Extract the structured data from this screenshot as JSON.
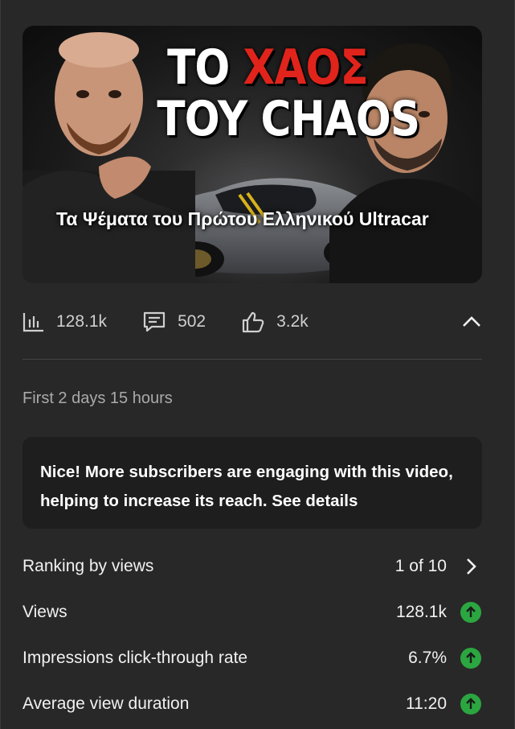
{
  "thumbnail": {
    "title_line1_white": "TO",
    "title_line1_red": "ΧΑΟΣ",
    "title_line2": "TOY CHAOS",
    "caption": "Τα Ψέματα του Πρώτου Ελληνικού Ultracar"
  },
  "stats": {
    "views": "128.1k",
    "comments": "502",
    "likes": "3.2k",
    "views_icon": "bar-chart-icon",
    "comments_icon": "comment-icon",
    "likes_icon": "thumbs-up-icon",
    "collapse_icon": "chevron-up-icon"
  },
  "period": "First 2 days 15 hours",
  "notice": "Nice! More subscribers are engaging with this video, helping to increase its reach. See details",
  "metrics": [
    {
      "label": "Ranking by views",
      "value": "1 of 10",
      "indicator": "chevron-right-icon"
    },
    {
      "label": "Views",
      "value": "128.1k",
      "indicator": "up-arrow-icon"
    },
    {
      "label": "Impressions click-through rate",
      "value": "6.7%",
      "indicator": "up-arrow-icon"
    },
    {
      "label": "Average view duration",
      "value": "11:20",
      "indicator": "up-arrow-icon"
    }
  ],
  "colors": {
    "background": "#282828",
    "notice_bg": "#1e1e1e",
    "positive": "#2ba640",
    "title_red": "#e0241b"
  }
}
